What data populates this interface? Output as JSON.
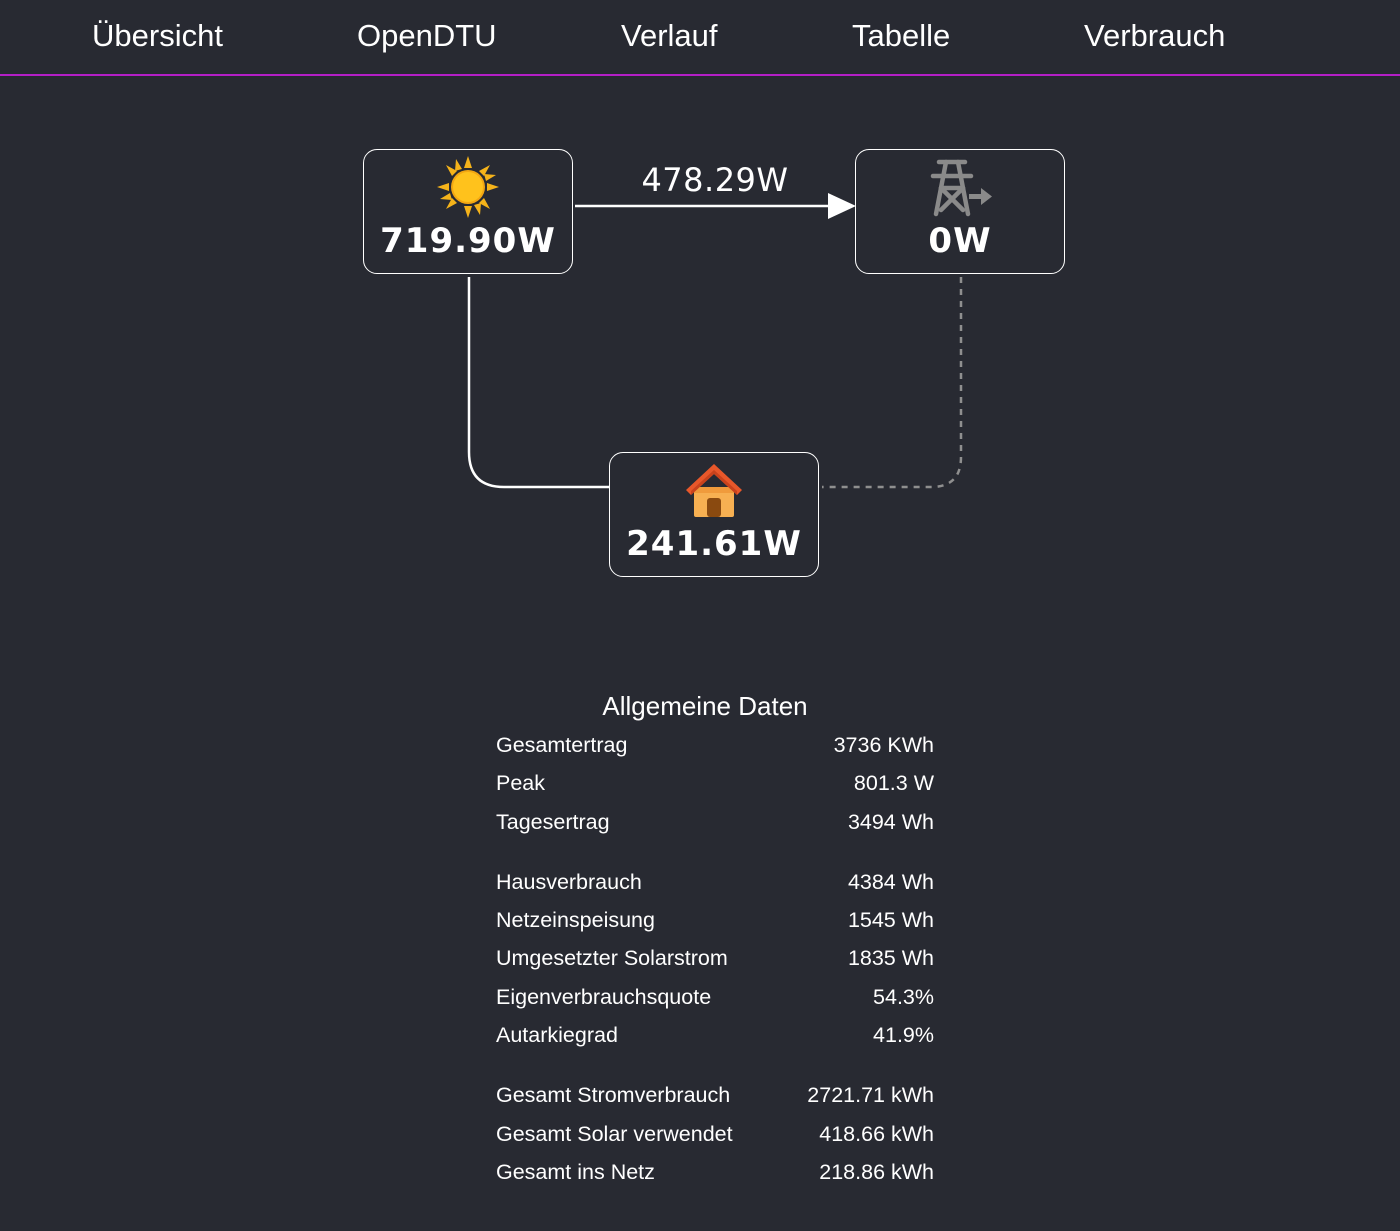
{
  "nav": {
    "items": [
      {
        "label": "Übersicht"
      },
      {
        "label": "OpenDTU"
      },
      {
        "label": "Verlauf"
      },
      {
        "label": "Tabelle"
      },
      {
        "label": "Verbrauch"
      }
    ]
  },
  "flow": {
    "solar": {
      "icon": "sun-icon",
      "value": "719.90W"
    },
    "grid": {
      "icon": "power-grid-export-icon",
      "value": "0W"
    },
    "house": {
      "icon": "house-icon",
      "value": "241.61W"
    },
    "solar_to_grid": {
      "value": "478.29W"
    }
  },
  "colors": {
    "background": "#282a32",
    "accent": "#b41fc7",
    "text": "#ffffff",
    "grid_icon": "#8a8a8a",
    "sun": "#f5b31a",
    "house_roof": "#e8572a",
    "house_wall": "#f7b052"
  },
  "general": {
    "title": "Allgemeine Daten",
    "groups": [
      [
        {
          "label": "Gesamtertrag",
          "value": "3736 KWh"
        },
        {
          "label": "Peak",
          "value": "801.3 W"
        },
        {
          "label": "Tagesertrag",
          "value": "3494 Wh"
        }
      ],
      [
        {
          "label": "Hausverbrauch",
          "value": "4384 Wh"
        },
        {
          "label": "Netzeinspeisung",
          "value": "1545 Wh"
        },
        {
          "label": "Umgesetzter Solarstrom",
          "value": "1835 Wh"
        },
        {
          "label": "Eigenverbrauchsquote",
          "value": "54.3%"
        },
        {
          "label": "Autarkiegrad",
          "value": "41.9%"
        }
      ],
      [
        {
          "label": "Gesamt Stromverbrauch",
          "value": "2721.71 kWh"
        },
        {
          "label": "Gesamt Solar verwendet",
          "value": "418.66 kWh"
        },
        {
          "label": "Gesamt ins Netz",
          "value": "218.86 kWh"
        }
      ]
    ]
  }
}
